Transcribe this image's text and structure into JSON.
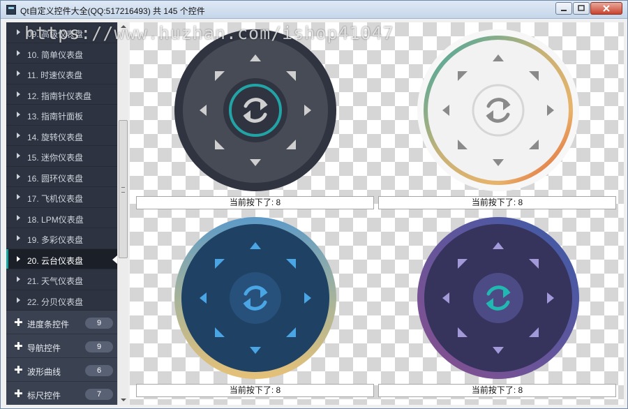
{
  "window": {
    "title": "Qt自定义控件大全(QQ:517216493) 共 145 个控件"
  },
  "watermark": "https://www.huzhan.com/ishop41047",
  "sidebar": {
    "items": [
      {
        "label": "09. 高级仪表盘"
      },
      {
        "label": "10. 简单仪表盘"
      },
      {
        "label": "11. 时速仪表盘"
      },
      {
        "label": "12. 指南针仪表盘"
      },
      {
        "label": "13. 指南针面板"
      },
      {
        "label": "14. 旋转仪表盘"
      },
      {
        "label": "15. 迷你仪表盘"
      },
      {
        "label": "16. 圆环仪表盘"
      },
      {
        "label": "17. 飞机仪表盘"
      },
      {
        "label": "18. LPM仪表盘"
      },
      {
        "label": "19. 多彩仪表盘"
      },
      {
        "label": "20. 云台仪表盘"
      },
      {
        "label": "21. 天气仪表盘"
      },
      {
        "label": "22. 分贝仪表盘"
      }
    ],
    "groups": [
      {
        "label": "进度条控件",
        "count": "9"
      },
      {
        "label": "导航控件",
        "count": "9"
      },
      {
        "label": "波形曲线",
        "count": "6"
      },
      {
        "label": "标尺控件",
        "count": "7"
      }
    ]
  },
  "gauges": [
    {
      "status": "当前按下了: 8",
      "colors": {
        "outer": "#2f3440",
        "inner": "#474b56",
        "center": "#2f3440",
        "arrow": "#cfcfcf",
        "icon": "#cfcfcf",
        "ring": "#22a3a6"
      }
    },
    {
      "status": "当前按下了: 8",
      "colors": {
        "outer": "#f7f7f7",
        "inner": "#f2f2f2",
        "center": "#f3f3f3",
        "arrow": "#8a8a8a",
        "icon": "#8a8a8a",
        "ring": "#d6d6d6"
      }
    },
    {
      "status": "当前按下了: 8",
      "colors": {
        "outer": "#213f5e",
        "inner": "#1f4264",
        "center": "#27507a",
        "arrow": "#4aa5e4",
        "icon": "#4aa5e4",
        "ring": "#d9b770"
      }
    },
    {
      "status": "当前按下了: 8",
      "colors": {
        "outer": "#3d3a66",
        "inner": "#36345d",
        "center": "#4d4b86",
        "arrow": "#a29ad8",
        "icon": "#21b8b2",
        "ring": "#3b5ba8"
      }
    }
  ]
}
